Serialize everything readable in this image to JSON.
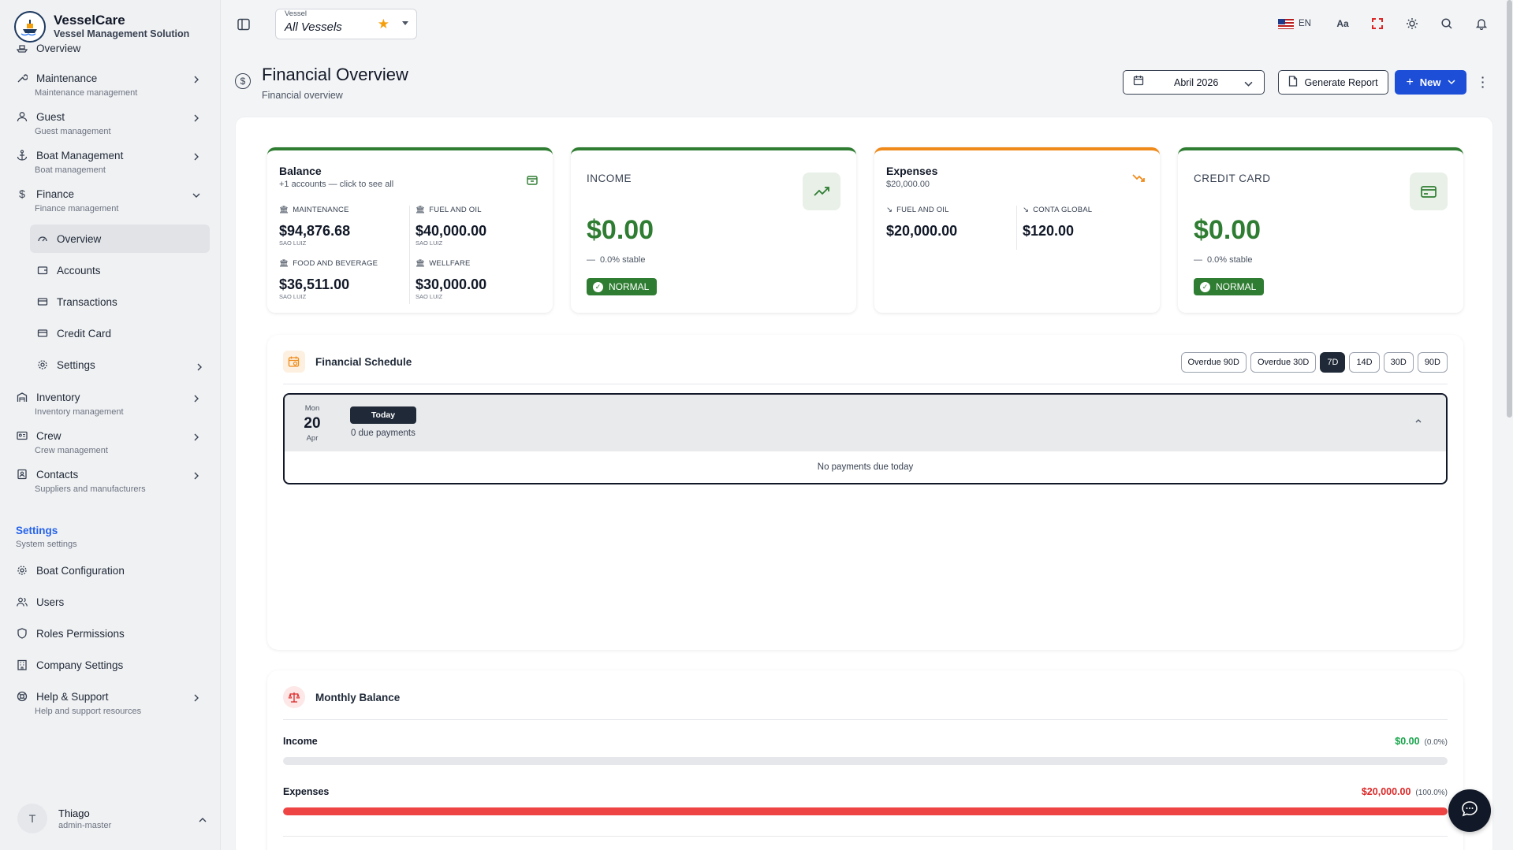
{
  "brand": {
    "title": "VesselCare",
    "subtitle": "Vessel Management Solution"
  },
  "sidebar": {
    "items": [
      {
        "label": "Overview"
      },
      {
        "label": "Maintenance",
        "sub": "Maintenance management"
      },
      {
        "label": "Guest",
        "sub": "Guest management"
      },
      {
        "label": "Boat Management",
        "sub": "Boat management"
      },
      {
        "label": "Finance",
        "sub": "Finance management"
      },
      {
        "label": "Inventory",
        "sub": "Inventory management"
      },
      {
        "label": "Crew",
        "sub": "Crew management"
      },
      {
        "label": "Contacts",
        "sub": "Suppliers and manufacturers"
      }
    ],
    "finance_children": [
      {
        "label": "Overview",
        "active": true
      },
      {
        "label": "Accounts"
      },
      {
        "label": "Transactions"
      },
      {
        "label": "Credit Card"
      },
      {
        "label": "Settings"
      }
    ],
    "settings_section": {
      "title": "Settings",
      "sub": "System settings"
    },
    "settings_items": [
      {
        "label": "Boat Configuration"
      },
      {
        "label": "Users"
      },
      {
        "label": "Roles Permissions"
      },
      {
        "label": "Company Settings"
      },
      {
        "label": "Help & Support",
        "sub": "Help and support resources"
      }
    ],
    "user": {
      "initial": "T",
      "name": "Thiago",
      "role": "admin-master"
    }
  },
  "topbar": {
    "vessel_label": "Vessel",
    "vessel_value": "All Vessels",
    "lang": "EN",
    "font_icon_text": "Aa"
  },
  "page": {
    "title": "Financial Overview",
    "subtitle": "Financial overview",
    "month": "Abril 2026",
    "generate_label": "Generate Report",
    "new_label": "New"
  },
  "cards": {
    "balance": {
      "title": "Balance",
      "sub": "+1 accounts — click to see all",
      "accounts": [
        {
          "name": "MAINTENANCE",
          "value": "$94,876.68",
          "loc": "SAO LUIZ"
        },
        {
          "name": "FUEL AND OIL",
          "value": "$40,000.00",
          "loc": "SAO LUIZ"
        },
        {
          "name": "FOOD AND BEVERAGE",
          "value": "$36,511.00",
          "loc": "SAO LUIZ"
        },
        {
          "name": "WELLFARE",
          "value": "$30,000.00",
          "loc": "SAO LUIZ"
        }
      ]
    },
    "income": {
      "label": "INCOME",
      "value": "$0.00",
      "trend": "0.0% stable",
      "badge": "NORMAL"
    },
    "expenses": {
      "title": "Expenses",
      "sub": "$20,000.00",
      "items": [
        {
          "name": "FUEL AND OIL",
          "value": "$20,000.00"
        },
        {
          "name": "CONTA GLOBAL",
          "value": "$120.00"
        }
      ]
    },
    "credit": {
      "label": "CREDIT CARD",
      "value": "$0.00",
      "trend": "0.0% stable",
      "badge": "NORMAL"
    }
  },
  "schedule": {
    "title": "Financial Schedule",
    "filters": [
      "Overdue 90D",
      "Overdue 30D",
      "7D",
      "14D",
      "30D",
      "90D"
    ],
    "active_filter": "7D",
    "day": {
      "dow": "Mon",
      "num": "20",
      "mon": "Apr",
      "pill": "Today",
      "count": "0 due payments",
      "empty": "No payments due today"
    }
  },
  "monthly": {
    "title": "Monthly Balance",
    "income": {
      "label": "Income",
      "amount": "$0.00",
      "pct": "(0.0%)",
      "fraction": 0.0
    },
    "expenses": {
      "label": "Expenses",
      "amount": "$20,000.00",
      "pct": "(100.0%)",
      "fraction": 1.0
    }
  },
  "colors": {
    "accent_green": "#2f7d32",
    "accent_orange": "#ef8a1a",
    "primary_blue": "#1d4ed8",
    "income_green": "#16a34a",
    "expense_red": "#dc2626",
    "bar_red": "#ef4444"
  },
  "icons": [
    "ship-logo-icon",
    "wrench-icon",
    "user-icon",
    "anchor-icon",
    "dollar-icon",
    "gauge-icon",
    "wallet-icon",
    "card-icon",
    "gear-icon",
    "warehouse-icon",
    "id-card-icon",
    "contact-book-icon",
    "shield-icon",
    "building-icon",
    "lifebuoy-icon",
    "calendar-icon",
    "document-icon",
    "plus-icon",
    "trend-up-icon",
    "trend-down-icon",
    "scale-icon",
    "chat-icon",
    "sun-icon",
    "search-icon",
    "bell-icon",
    "fullscreen-icon",
    "sidebar-toggle-icon",
    "star-icon"
  ]
}
